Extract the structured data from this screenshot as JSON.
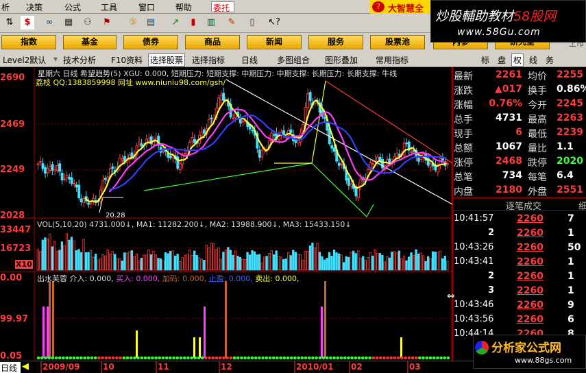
{
  "menu": {
    "items": [
      "析",
      "决策",
      "公式",
      "工具",
      "窗口",
      "帮助"
    ],
    "weituo": "委托",
    "brand": "大智慧全"
  },
  "watermark": {
    "line1_a": "炒股輔助教材",
    "line1_b": "58股网",
    "line2": "www.58Gu.com"
  },
  "nav_buttons": [
    "指数",
    "基金",
    "债券",
    "商品",
    "新闻",
    "服务",
    "股票池",
    "内参",
    "研究室"
  ],
  "nav_extra": "上市",
  "tabs": {
    "items": [
      "Level2默认",
      "技术分析",
      "F10资料",
      "选择股票",
      "选择指标",
      "日线",
      "多图组合",
      "图形叠加",
      "常用指标"
    ],
    "right": [
      "标",
      "盘",
      "权",
      "线",
      "务"
    ]
  },
  "chart": {
    "header": "星期六  日线 希望趋势(5) XGU: 0.000, 短期压力: 短期支撑: 中期压力: 中期支撑: 长期压力: 长期支撑: 牛线",
    "url_line": "荔枝 QQ:1383859998 网址 www.niuniu98.com/gsh/",
    "y_ticks": [
      "2690",
      "2469",
      "2249",
      "2028"
    ],
    "low_label": "20.28",
    "vol_info": "VOL(5,10,20)  4731.000↓, MA1: 11282.200↓, MA2: 13988.900↓, MA3: 15433.150↓",
    "vol_ticks": [
      "33447",
      "16723",
      "X10"
    ],
    "ind_info": {
      "name": "出水芙蓉",
      "a": "介入: 0.000,",
      "b": "买入: 0.000,",
      "c": "加码: 0.000,",
      "d": "止盈: 0.000,",
      "e": "卖出: 0.000,"
    },
    "ind_ticks": [
      "0.00",
      "99.97",
      "0.05"
    ],
    "x_ticks": [
      "2009/09",
      "10",
      "11",
      "12",
      "2010/01",
      "02",
      "03"
    ],
    "colors": {
      "up": "#ff3b3b",
      "down": "#40e0ff",
      "ma_yellow": "#ffff40",
      "ma_purple": "#ff40ff",
      "ma_blue": "#3040ff"
    }
  },
  "quote": {
    "rows": [
      {
        "l1": "最新",
        "v1": "2261",
        "l2": "均价",
        "v2": "2255"
      },
      {
        "l1": "涨跌",
        "v1": "▲017",
        "l2": "换手",
        "v2": "0.86%"
      },
      {
        "l1": "涨幅",
        "v1": "0.76%",
        "l2": "今开",
        "v2": "2245"
      },
      {
        "l1": "总手",
        "v1": "4731",
        "l2": "最高",
        "v2": "2263"
      },
      {
        "l1": "现手",
        "v1": "6",
        "l2": "最低",
        "v2": "2239"
      },
      {
        "l1": "总额",
        "v1": "1067",
        "l2": "量比",
        "v2": "1.1"
      },
      {
        "l1": "涨停",
        "v1": "2468",
        "l2": "跌停",
        "v2": "2020"
      },
      {
        "l1": "总笔",
        "v1": "734",
        "l2": "每笔",
        "v2": "6.4"
      },
      {
        "l1": "内盘",
        "v1": "2180",
        "l2": "外盘",
        "v2": "2551"
      }
    ],
    "trades_header": "逐笔成交",
    "trades_header2": "细",
    "trades": [
      {
        "t": "10:41:57",
        "p": "2260",
        "q": "7"
      },
      {
        "t": "",
        "p": "2260",
        "q": "1",
        "pre": "2"
      },
      {
        "t": "10:43:26",
        "p": "2260",
        "q": "50"
      },
      {
        "t": "10:43:41",
        "p": "2260",
        "q": "1",
        "pre": "2"
      },
      {
        "t": "",
        "p": "2260",
        "q": "1",
        "pre": "2"
      },
      {
        "t": "",
        "p": "2260",
        "q": "1",
        "pre": "3"
      },
      {
        "t": "10:43:46",
        "p": "2260",
        "q": "9"
      },
      {
        "t": "10:43:56",
        "p": "2260",
        "q": "6"
      },
      {
        "t": "10:44:14",
        "p": "2260",
        "q": "8"
      }
    ]
  },
  "bottom": {
    "tab": "日线",
    "logo": "分析家公式网",
    "logo_url": "www.88gs.com"
  }
}
